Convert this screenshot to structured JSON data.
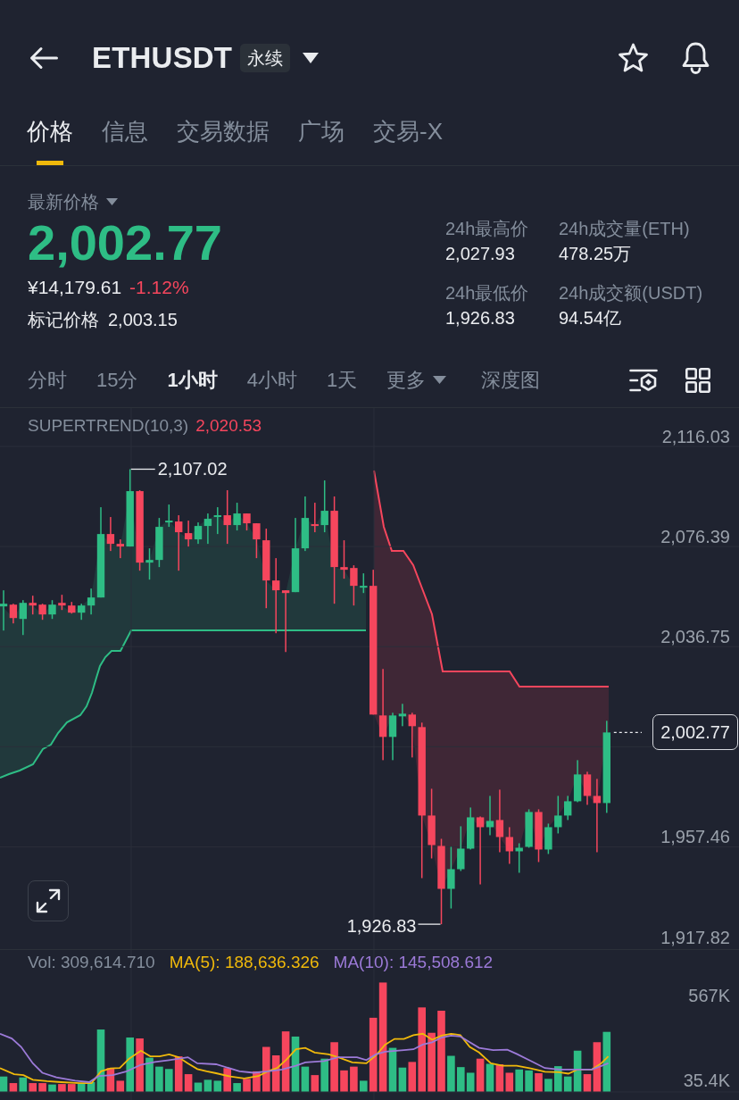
{
  "header": {
    "title": "ETHUSDT",
    "badge": "永续"
  },
  "tabs": [
    {
      "label": "价格",
      "selected": true
    },
    {
      "label": "信息",
      "selected": false
    },
    {
      "label": "交易数据",
      "selected": false
    },
    {
      "label": "广场",
      "selected": false
    },
    {
      "label": "交易-X",
      "selected": false
    }
  ],
  "price_panel": {
    "label": "最新价格",
    "last_price": "2,002.77",
    "last_price_rising": true,
    "cny_price": "¥14,179.61",
    "change": "-1.12%",
    "change_rising": false,
    "mark_price_label": "标记价格",
    "mark_price": "2,003.15",
    "stats": [
      {
        "label": "24h最高价",
        "value": "2,027.93"
      },
      {
        "label": "24h成交量(ETH)",
        "value": "478.25万"
      },
      {
        "label": "24h最低价",
        "value": "1,926.83"
      },
      {
        "label": "24h成交额(USDT)",
        "value": "94.54亿"
      }
    ]
  },
  "intervals": [
    {
      "label": "分时",
      "kind": "option",
      "selected": false
    },
    {
      "label": "15分",
      "kind": "option",
      "selected": false
    },
    {
      "label": "1小时",
      "kind": "option",
      "selected": true
    },
    {
      "label": "4小时",
      "kind": "option",
      "selected": false
    },
    {
      "label": "1天",
      "kind": "option",
      "selected": false
    },
    {
      "label": "更多",
      "kind": "menu",
      "selected": false
    },
    {
      "label": "深度图",
      "kind": "option",
      "selected": false
    }
  ],
  "chart": {
    "indicator": {
      "name": "SUPERTREND(10,3)",
      "value": "2,020.53"
    },
    "chart_data": {
      "type": "candlestick",
      "ohlc": [
        [
          2052.68,
          2059.05,
          2043.12,
          2053.74
        ],
        [
          2053.38,
          2053.74,
          2045.95,
          2048.07
        ],
        [
          2047.72,
          2055.15,
          2041.35,
          2054.09
        ],
        [
          2054.09,
          2056.92,
          2049.49,
          2053.03
        ],
        [
          2053.38,
          2053.74,
          2047.37,
          2049.49
        ],
        [
          2049.49,
          2055.15,
          2047.72,
          2053.38
        ],
        [
          2054.09,
          2057.28,
          2051.26,
          2053.03
        ],
        [
          2053.03,
          2054.45,
          2049.84,
          2050.2
        ],
        [
          2050.2,
          2053.74,
          2047.37,
          2053.03
        ],
        [
          2053.03,
          2059.75,
          2049.49,
          2056.21
        ],
        [
          2056.21,
          2091.96,
          2056.21,
          2081.34
        ],
        [
          2081.34,
          2088.07,
          2074.62,
          2077.45
        ],
        [
          2077.45,
          2079.22,
          2071.79,
          2076.39
        ],
        [
          2076.39,
          2107.02,
          2076.39,
          2098.33
        ],
        [
          2098.33,
          2098.69,
          2066.83,
          2070.02
        ],
        [
          2070.02,
          2075.68,
          2063.29,
          2071.08
        ],
        [
          2071.08,
          2087.71,
          2068.25,
          2084.18
        ],
        [
          2085.94,
          2093.02,
          2084.18,
          2086.65
        ],
        [
          2086.3,
          2088.78,
          2066.83,
          2082.05
        ],
        [
          2081.7,
          2086.65,
          2076.39,
          2079.22
        ],
        [
          2079.22,
          2085.94,
          2077.45,
          2084.53
        ],
        [
          2084.53,
          2089.48,
          2077.45,
          2087.36
        ],
        [
          2088.07,
          2091.96,
          2081.34,
          2088.78
        ],
        [
          2088.78,
          2098.69,
          2077.45,
          2084.88
        ],
        [
          2084.88,
          2093.73,
          2082.76,
          2089.48
        ],
        [
          2089.48,
          2089.48,
          2082.76,
          2085.59
        ],
        [
          2085.59,
          2085.59,
          2071.79,
          2079.22
        ],
        [
          2078.87,
          2083.47,
          2051.97,
          2062.94
        ],
        [
          2062.94,
          2071.79,
          2042.06,
          2059.05
        ],
        [
          2059.05,
          2059.05,
          2034.62,
          2057.98
        ],
        [
          2058.34,
          2087.71,
          2058.34,
          2075.68
        ],
        [
          2075.68,
          2096.21,
          2074.62,
          2087.71
        ],
        [
          2085.24,
          2093.73,
          2082.05,
          2084.53
        ],
        [
          2084.88,
          2102.58,
          2082.05,
          2090.55
        ],
        [
          2090.55,
          2096.21,
          2053.74,
          2068.25
        ],
        [
          2068.25,
          2078.87,
          2063.65,
          2067.19
        ],
        [
          2067.89,
          2068.96,
          2053.03,
          2060.82
        ],
        [
          2060.46,
          2065.77,
          2057.98,
          2060.82
        ],
        [
          2060.82,
          2067.19,
          2009.85,
          2009.85
        ],
        [
          2009.5,
          2027.9,
          1991.8,
          2001
        ],
        [
          2001,
          2010.56,
          1991.8,
          2009.5
        ],
        [
          2009.14,
          2014.1,
          2005.25,
          2010.2
        ],
        [
          2009.85,
          2010.56,
          1992.86,
          2005.25
        ],
        [
          2004.89,
          2006.66,
          1945.08,
          1969.86
        ],
        [
          1969.86,
          1980.47,
          1952.87,
          1958.18
        ],
        [
          1957.82,
          1960.65,
          1926.83,
          1940.83
        ],
        [
          1940.83,
          1957.47,
          1933.05,
          1948.62
        ],
        [
          1948.62,
          1965.61,
          1947.91,
          1956.76
        ],
        [
          1956.76,
          1973.04,
          1956.41,
          1969.15
        ],
        [
          1969.15,
          1969.5,
          1942.6,
          1965.25
        ],
        [
          1965.25,
          1977.64,
          1962.07,
          1967.73
        ],
        [
          1968.09,
          1980.12,
          1955.34,
          1961.36
        ],
        [
          1961.36,
          1965.25,
          1950.74,
          1955.7
        ],
        [
          1955.7,
          1958.88,
          1947.2,
          1957.11
        ],
        [
          1957.47,
          1972.33,
          1957.11,
          1971.27
        ],
        [
          1971.27,
          1972.33,
          1951.45,
          1956.41
        ],
        [
          1956.41,
          1966.67,
          1954.64,
          1965.25
        ],
        [
          1965.25,
          1977.64,
          1962.78,
          1969.86
        ],
        [
          1969.86,
          1977.64,
          1968.09,
          1975.52
        ],
        [
          1975.52,
          1991.8,
          1975.16,
          1986.14
        ],
        [
          1986.14,
          1987.2,
          1974.1,
          1977.64
        ],
        [
          1977.64,
          1984.37,
          1955.34,
          1974.81
        ],
        [
          1974.81,
          2007.37,
          1970.92,
          2002.77
        ]
      ],
      "ylim": [
        1917.82,
        2116.03
      ],
      "yticks": [
        {
          "value": 2116.03,
          "label": "2,116.03"
        },
        {
          "value": 2076.39,
          "label": "2,076.39"
        },
        {
          "value": 2036.75,
          "label": "2,036.75"
        },
        {
          "value": 1957.46,
          "label": "1,957.46"
        },
        {
          "value": 1917.82,
          "label": "1,917.82"
        }
      ],
      "grid": true
    },
    "high_label": "2,107.02",
    "low_label": "1,926.83",
    "current_price": "2,002.77"
  },
  "volume": {
    "legend": [
      {
        "label": "Vol: 309,614.710",
        "color": "#848e9c"
      },
      {
        "label": "MA(5): 188,636.326",
        "color": "#f0b90b"
      },
      {
        "label": "MA(10): 145,508.612",
        "color": "#9c7ad8"
      }
    ],
    "axis": [
      "567K",
      "35.4K"
    ]
  }
}
